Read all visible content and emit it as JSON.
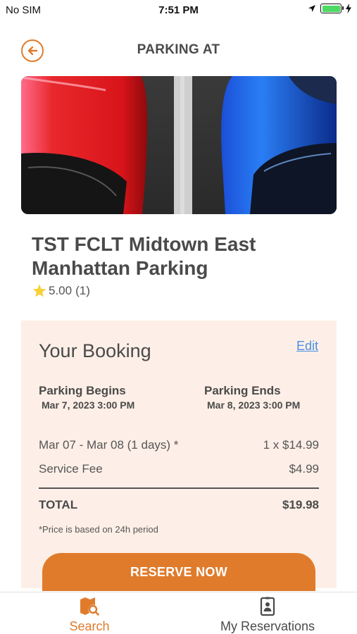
{
  "status_bar": {
    "carrier": "No SIM",
    "time": "7:51 PM",
    "icons": [
      "location-arrow-icon",
      "battery-icon",
      "charging-bolt-icon"
    ]
  },
  "header": {
    "title": "PARKING AT",
    "back_icon": "back-arrow-circle-icon"
  },
  "listing": {
    "name": "TST FCLT Midtown East Manhattan Parking",
    "rating": "5.00",
    "review_count": "(1)"
  },
  "booking": {
    "title": "Your Booking",
    "edit_label": "Edit",
    "begins_label": "Parking Begins",
    "begins_value": "Mar 7, 2023 3:00 PM",
    "ends_label": "Parking Ends",
    "ends_value": "Mar 8, 2023 3:00 PM",
    "line_items": [
      {
        "label": "Mar 07 - Mar 08 (1 days) *",
        "amount": "1 x $14.99"
      },
      {
        "label": "Service Fee",
        "amount": "$4.99"
      }
    ],
    "total_label": "TOTAL",
    "total_value": "$19.98",
    "footnote": "*Price is based on 24h period",
    "reserve_label": "RESERVE NOW"
  },
  "tabs": [
    {
      "label": "Search",
      "icon": "map-search-icon",
      "active": true
    },
    {
      "label": "My Reservations",
      "icon": "reservation-badge-icon",
      "active": false
    }
  ],
  "colors": {
    "accent": "#e07b2c",
    "card_background": "#fdefe7",
    "link": "#4a90e2",
    "battery": "#4cd964"
  }
}
